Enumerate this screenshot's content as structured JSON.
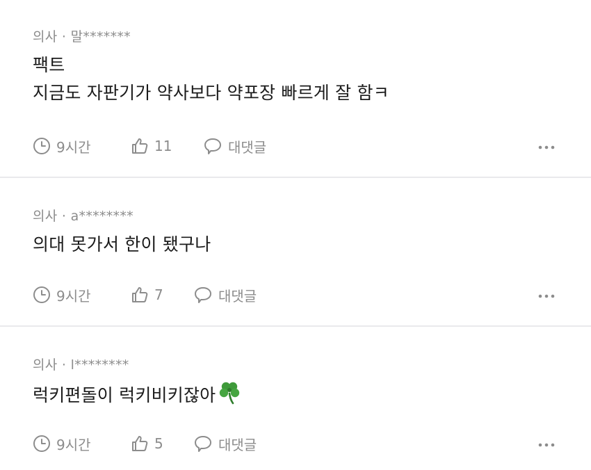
{
  "comments": [
    {
      "author_role": "의사",
      "separator": "·",
      "author_name": "말*******",
      "lines": [
        "팩트",
        "지금도 자판기가 약사보다 약포장 빠르게 잘 함ㅋ"
      ],
      "time": "9시간",
      "likes": "11",
      "reply_label": "대댓글"
    },
    {
      "author_role": "의사",
      "separator": "·",
      "author_name": "a********",
      "lines": [
        "의대 못가서 한이 됐구나"
      ],
      "time": "9시간",
      "likes": "7",
      "reply_label": "대댓글"
    },
    {
      "author_role": "의사",
      "separator": "·",
      "author_name": "l********",
      "lines": [
        "럭키편돌이 럭키비키잖아"
      ],
      "time": "9시간",
      "likes": "5",
      "reply_label": "대댓글"
    }
  ],
  "icons": {
    "time": "clock-icon",
    "like": "thumbs-up-icon",
    "reply": "speech-bubble-icon",
    "more": "more-dots-icon",
    "emoji": "four-leaf-clover-emoji"
  },
  "colors": {
    "meta_text": "#8c8c8c",
    "body_text": "#1b1b1b",
    "divider": "#e9e9ec",
    "clover_green": "#3f9a3a"
  }
}
